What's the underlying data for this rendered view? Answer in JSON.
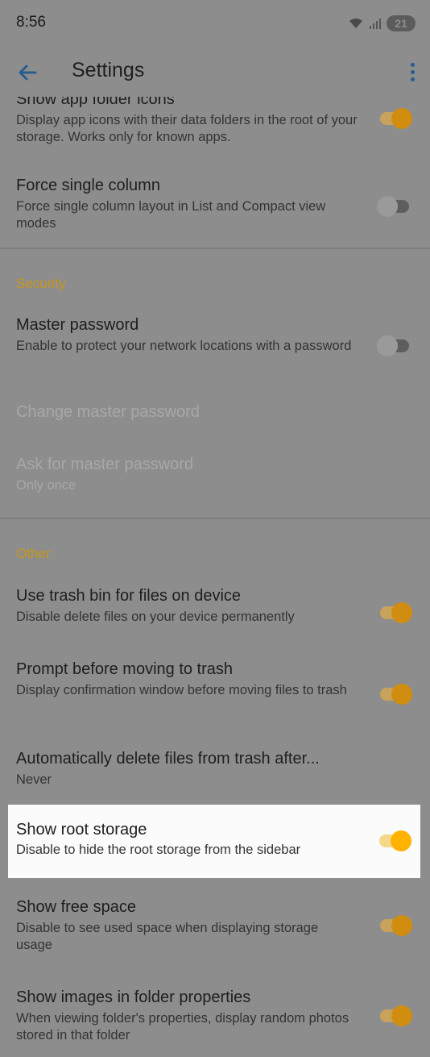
{
  "status_bar": {
    "time": "8:56",
    "battery": "21"
  },
  "toolbar": {
    "title": "Settings"
  },
  "items": {
    "show_app_icons": {
      "title": "Show app folder icons",
      "subtitle": "Display app icons with their data folders in the root of your storage. Works only for known apps.",
      "enabled": true
    },
    "force_single_column": {
      "title": "Force single column",
      "subtitle": "Force single column layout in List and Compact view modes",
      "enabled": false
    },
    "security_header": "Security",
    "master_password": {
      "title": "Master password",
      "subtitle": "Enable to protect your network locations with a password",
      "enabled": false
    },
    "change_master_password": {
      "title": "Change master password"
    },
    "ask_master_password": {
      "title": "Ask for master password",
      "subtitle": "Only once"
    },
    "other_header": "Other",
    "use_trash_bin": {
      "title": "Use trash bin for files on device",
      "subtitle": "Disable delete files on your device permanently",
      "enabled": true
    },
    "prompt_trash": {
      "title": "Prompt before moving to trash",
      "subtitle": "Display confirmation window before moving files to trash",
      "enabled": true
    },
    "auto_delete": {
      "title": "Automatically delete files from trash after...",
      "subtitle": "Never"
    },
    "show_root_storage": {
      "title": "Show root storage",
      "subtitle": "Disable to hide the root storage from the sidebar",
      "enabled": true
    },
    "show_free_space": {
      "title": "Show free space",
      "subtitle": "Disable to see used space when displaying storage usage",
      "enabled": true
    },
    "show_images_folder": {
      "title": "Show images in folder properties",
      "subtitle": "When viewing folder's properties, display random photos stored in that folder",
      "enabled": true
    }
  },
  "colors": {
    "accent": "#ffb300",
    "header": "#c8961a",
    "scrim": "#8d8d8d"
  }
}
